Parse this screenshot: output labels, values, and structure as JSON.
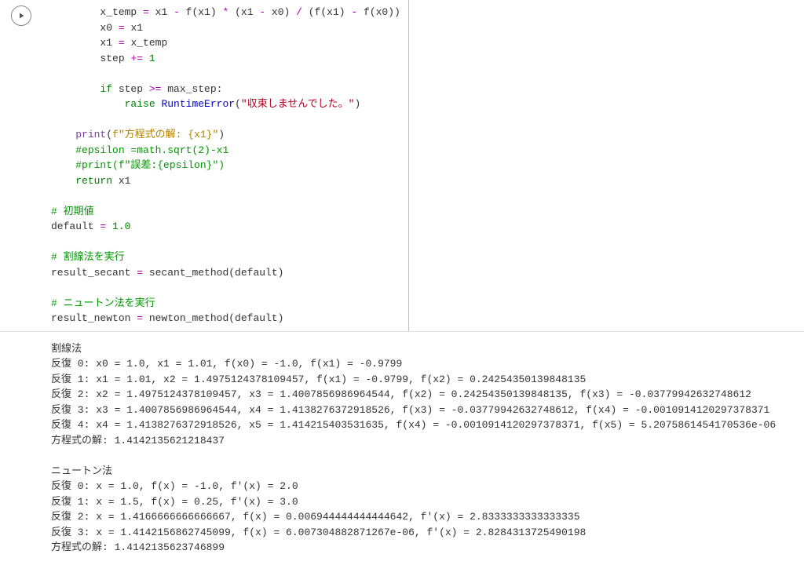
{
  "code": {
    "lines": [
      {
        "indent": 8,
        "tokens": [
          {
            "c": "plain",
            "t": "x_temp "
          },
          {
            "c": "op",
            "t": "="
          },
          {
            "c": "plain",
            "t": " x1 "
          },
          {
            "c": "op",
            "t": "-"
          },
          {
            "c": "plain",
            "t": " f(x1) "
          },
          {
            "c": "op",
            "t": "*"
          },
          {
            "c": "plain",
            "t": " (x1 "
          },
          {
            "c": "op",
            "t": "-"
          },
          {
            "c": "plain",
            "t": " x0) "
          },
          {
            "c": "op",
            "t": "/"
          },
          {
            "c": "plain",
            "t": " (f(x1) "
          },
          {
            "c": "op",
            "t": "-"
          },
          {
            "c": "plain",
            "t": " f(x0))"
          }
        ]
      },
      {
        "indent": 8,
        "tokens": [
          {
            "c": "plain",
            "t": "x0 "
          },
          {
            "c": "op",
            "t": "="
          },
          {
            "c": "plain",
            "t": " x1"
          }
        ]
      },
      {
        "indent": 8,
        "tokens": [
          {
            "c": "plain",
            "t": "x1 "
          },
          {
            "c": "op",
            "t": "="
          },
          {
            "c": "plain",
            "t": " x_temp"
          }
        ]
      },
      {
        "indent": 8,
        "tokens": [
          {
            "c": "plain",
            "t": "step "
          },
          {
            "c": "op",
            "t": "+="
          },
          {
            "c": "plain",
            "t": " "
          },
          {
            "c": "num",
            "t": "1"
          }
        ]
      },
      {
        "indent": 0,
        "tokens": []
      },
      {
        "indent": 8,
        "tokens": [
          {
            "c": "kw",
            "t": "if"
          },
          {
            "c": "plain",
            "t": " step "
          },
          {
            "c": "op",
            "t": ">="
          },
          {
            "c": "plain",
            "t": " max_step:"
          }
        ]
      },
      {
        "indent": 12,
        "tokens": [
          {
            "c": "kw",
            "t": "raise"
          },
          {
            "c": "plain",
            "t": " "
          },
          {
            "c": "fn2",
            "t": "RuntimeError"
          },
          {
            "c": "plain",
            "t": "("
          },
          {
            "c": "err",
            "t": "\"収束しませんでした。\""
          },
          {
            "c": "plain",
            "t": ")"
          }
        ]
      },
      {
        "indent": 0,
        "tokens": []
      },
      {
        "indent": 4,
        "tokens": [
          {
            "c": "fn",
            "t": "print"
          },
          {
            "c": "plain",
            "t": "("
          },
          {
            "c": "str",
            "t": "f\"方程式の解: {x1}\""
          },
          {
            "c": "plain",
            "t": ")"
          }
        ]
      },
      {
        "indent": 4,
        "tokens": [
          {
            "c": "cmt",
            "t": "#epsilon =math.sqrt(2)-x1"
          }
        ]
      },
      {
        "indent": 4,
        "tokens": [
          {
            "c": "cmt",
            "t": "#print(f\"誤差:{epsilon}\")"
          }
        ]
      },
      {
        "indent": 4,
        "tokens": [
          {
            "c": "kw",
            "t": "return"
          },
          {
            "c": "plain",
            "t": " x1"
          }
        ]
      },
      {
        "indent": 0,
        "tokens": []
      },
      {
        "indent": 0,
        "tokens": [
          {
            "c": "cmt",
            "t": "# 初期値"
          }
        ]
      },
      {
        "indent": 0,
        "tokens": [
          {
            "c": "plain",
            "t": "default "
          },
          {
            "c": "op",
            "t": "="
          },
          {
            "c": "plain",
            "t": " "
          },
          {
            "c": "num",
            "t": "1.0"
          }
        ]
      },
      {
        "indent": 0,
        "tokens": []
      },
      {
        "indent": 0,
        "tokens": [
          {
            "c": "cmt",
            "t": "# 割線法を実行"
          }
        ]
      },
      {
        "indent": 0,
        "tokens": [
          {
            "c": "plain",
            "t": "result_secant "
          },
          {
            "c": "op",
            "t": "="
          },
          {
            "c": "plain",
            "t": " secant_method(default)"
          }
        ]
      },
      {
        "indent": 0,
        "tokens": []
      },
      {
        "indent": 0,
        "tokens": [
          {
            "c": "cmt",
            "t": "# ニュートン法を実行"
          }
        ]
      },
      {
        "indent": 0,
        "tokens": [
          {
            "c": "plain",
            "t": "result_newton "
          },
          {
            "c": "op",
            "t": "="
          },
          {
            "c": "plain",
            "t": " newton_method(default)"
          }
        ]
      }
    ]
  },
  "output": {
    "lines": [
      "割線法",
      "反復 0: x0 = 1.0, x1 = 1.01, f(x0) = -1.0, f(x1) = -0.9799",
      "反復 1: x1 = 1.01, x2 = 1.4975124378109457, f(x1) = -0.9799, f(x2) = 0.24254350139848135",
      "反復 2: x2 = 1.4975124378109457, x3 = 1.4007856986964544, f(x2) = 0.24254350139848135, f(x3) = -0.03779942632748612",
      "反復 3: x3 = 1.4007856986964544, x4 = 1.4138276372918526, f(x3) = -0.03779942632748612, f(x4) = -0.0010914120297378371",
      "反復 4: x4 = 1.4138276372918526, x5 = 1.414215403531635, f(x4) = -0.0010914120297378371, f(x5) = 5.2075861454170536e-06",
      "方程式の解: 1.4142135621218437",
      "",
      "ニュートン法",
      "反復 0: x = 1.0, f(x) = -1.0, f'(x) = 2.0",
      "反復 1: x = 1.5, f(x) = 0.25, f'(x) = 3.0",
      "反復 2: x = 1.4166666666666667, f(x) = 0.006944444444444642, f'(x) = 2.8333333333333335",
      "反復 3: x = 1.4142156862745099, f(x) = 6.007304882871267e-06, f'(x) = 2.8284313725490198",
      "方程式の解: 1.4142135623746899"
    ]
  }
}
